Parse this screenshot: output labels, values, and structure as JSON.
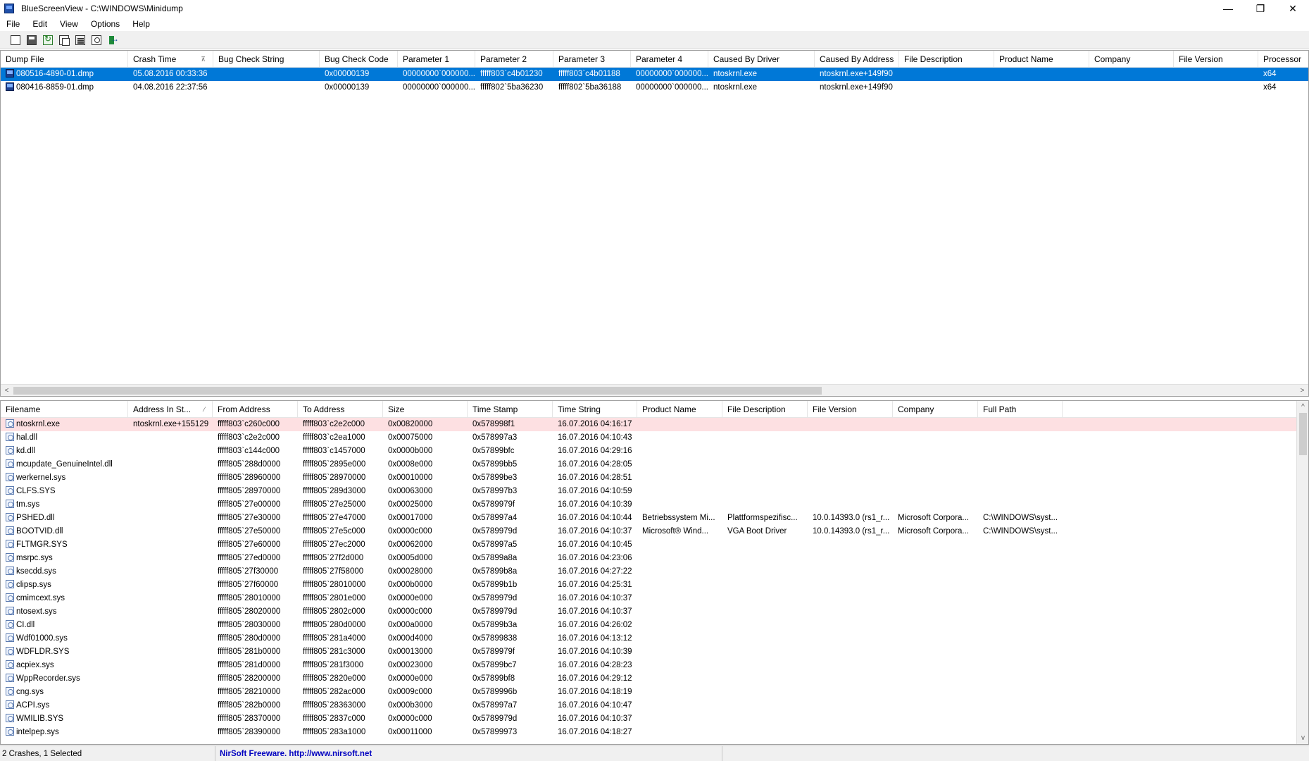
{
  "window": {
    "title": "BlueScreenView  -  C:\\WINDOWS\\Minidump",
    "controls": {
      "minimize": "—",
      "restore": "❐",
      "close": "✕"
    }
  },
  "menu": [
    "File",
    "Edit",
    "View",
    "Options",
    "Help"
  ],
  "toolbar": [
    "html-report-icon",
    "save-icon",
    "refresh-icon",
    "copy-icon",
    "properties-icon",
    "find-icon",
    "exit-icon"
  ],
  "colors": {
    "selection": "#0078d7",
    "highlight_row": "#fde0e2",
    "freeware_link": "#0000c0"
  },
  "crash_list": {
    "sort_indicator": "⊼",
    "columns": [
      "Dump File",
      "Crash Time",
      "Bug Check String",
      "Bug Check Code",
      "Parameter 1",
      "Parameter 2",
      "Parameter 3",
      "Parameter 4",
      "Caused By Driver",
      "Caused By Address",
      "File Description",
      "Product Name",
      "Company",
      "File Version",
      "Processor"
    ],
    "rows": [
      {
        "selected": true,
        "cells": [
          "080516-4890-01.dmp",
          "05.08.2016 00:33:36",
          "",
          "0x00000139",
          "00000000`000000...",
          "fffff803`c4b01230",
          "fffff803`c4b01188",
          "00000000`000000...",
          "ntoskrnl.exe",
          "ntoskrnl.exe+149f90",
          "",
          "",
          "",
          "",
          "x64"
        ]
      },
      {
        "selected": false,
        "cells": [
          "080416-8859-01.dmp",
          "04.08.2016 22:37:56",
          "",
          "0x00000139",
          "00000000`000000...",
          "fffff802`5ba36230",
          "fffff802`5ba36188",
          "00000000`000000...",
          "ntoskrnl.exe",
          "ntoskrnl.exe+149f90",
          "",
          "",
          "",
          "",
          "x64"
        ]
      }
    ]
  },
  "module_list": {
    "sort_indicator": "⁄",
    "columns": [
      "Filename",
      "Address In St...",
      "From Address",
      "To Address",
      "Size",
      "Time Stamp",
      "Time String",
      "Product Name",
      "File Description",
      "File Version",
      "Company",
      "Full Path"
    ],
    "rows": [
      {
        "highlight": true,
        "cells": [
          "ntoskrnl.exe",
          "ntoskrnl.exe+155129",
          "fffff803`c260c000",
          "fffff803`c2e2c000",
          "0x00820000",
          "0x578998f1",
          "16.07.2016 04:16:17",
          "",
          "",
          "",
          "",
          ""
        ]
      },
      {
        "highlight": false,
        "cells": [
          "hal.dll",
          "",
          "fffff803`c2e2c000",
          "fffff803`c2ea1000",
          "0x00075000",
          "0x578997a3",
          "16.07.2016 04:10:43",
          "",
          "",
          "",
          "",
          ""
        ]
      },
      {
        "highlight": false,
        "cells": [
          "kd.dll",
          "",
          "fffff803`c144c000",
          "fffff803`c1457000",
          "0x0000b000",
          "0x57899bfc",
          "16.07.2016 04:29:16",
          "",
          "",
          "",
          "",
          ""
        ]
      },
      {
        "highlight": false,
        "cells": [
          "mcupdate_GenuineIntel.dll",
          "",
          "fffff805`288d0000",
          "fffff805`2895e000",
          "0x0008e000",
          "0x57899bb5",
          "16.07.2016 04:28:05",
          "",
          "",
          "",
          "",
          ""
        ]
      },
      {
        "highlight": false,
        "cells": [
          "werkernel.sys",
          "",
          "fffff805`28960000",
          "fffff805`28970000",
          "0x00010000",
          "0x57899be3",
          "16.07.2016 04:28:51",
          "",
          "",
          "",
          "",
          ""
        ]
      },
      {
        "highlight": false,
        "cells": [
          "CLFS.SYS",
          "",
          "fffff805`28970000",
          "fffff805`289d3000",
          "0x00063000",
          "0x578997b3",
          "16.07.2016 04:10:59",
          "",
          "",
          "",
          "",
          ""
        ]
      },
      {
        "highlight": false,
        "cells": [
          "tm.sys",
          "",
          "fffff805`27e00000",
          "fffff805`27e25000",
          "0x00025000",
          "0x5789979f",
          "16.07.2016 04:10:39",
          "",
          "",
          "",
          "",
          ""
        ]
      },
      {
        "highlight": false,
        "cells": [
          "PSHED.dll",
          "",
          "fffff805`27e30000",
          "fffff805`27e47000",
          "0x00017000",
          "0x578997a4",
          "16.07.2016 04:10:44",
          "Betriebssystem Mi...",
          "Plattformspezifisc...",
          "10.0.14393.0 (rs1_r...",
          "Microsoft Corpora...",
          "C:\\WINDOWS\\syst..."
        ]
      },
      {
        "highlight": false,
        "cells": [
          "BOOTVID.dll",
          "",
          "fffff805`27e50000",
          "fffff805`27e5c000",
          "0x0000c000",
          "0x5789979d",
          "16.07.2016 04:10:37",
          "Microsoft® Wind...",
          "VGA Boot Driver",
          "10.0.14393.0 (rs1_r...",
          "Microsoft Corpora...",
          "C:\\WINDOWS\\syst..."
        ]
      },
      {
        "highlight": false,
        "cells": [
          "FLTMGR.SYS",
          "",
          "fffff805`27e60000",
          "fffff805`27ec2000",
          "0x00062000",
          "0x578997a5",
          "16.07.2016 04:10:45",
          "",
          "",
          "",
          "",
          ""
        ]
      },
      {
        "highlight": false,
        "cells": [
          "msrpc.sys",
          "",
          "fffff805`27ed0000",
          "fffff805`27f2d000",
          "0x0005d000",
          "0x57899a8a",
          "16.07.2016 04:23:06",
          "",
          "",
          "",
          "",
          ""
        ]
      },
      {
        "highlight": false,
        "cells": [
          "ksecdd.sys",
          "",
          "fffff805`27f30000",
          "fffff805`27f58000",
          "0x00028000",
          "0x57899b8a",
          "16.07.2016 04:27:22",
          "",
          "",
          "",
          "",
          ""
        ]
      },
      {
        "highlight": false,
        "cells": [
          "clipsp.sys",
          "",
          "fffff805`27f60000",
          "fffff805`28010000",
          "0x000b0000",
          "0x57899b1b",
          "16.07.2016 04:25:31",
          "",
          "",
          "",
          "",
          ""
        ]
      },
      {
        "highlight": false,
        "cells": [
          "cmimcext.sys",
          "",
          "fffff805`28010000",
          "fffff805`2801e000",
          "0x0000e000",
          "0x5789979d",
          "16.07.2016 04:10:37",
          "",
          "",
          "",
          "",
          ""
        ]
      },
      {
        "highlight": false,
        "cells": [
          "ntosext.sys",
          "",
          "fffff805`28020000",
          "fffff805`2802c000",
          "0x0000c000",
          "0x5789979d",
          "16.07.2016 04:10:37",
          "",
          "",
          "",
          "",
          ""
        ]
      },
      {
        "highlight": false,
        "cells": [
          "CI.dll",
          "",
          "fffff805`28030000",
          "fffff805`280d0000",
          "0x000a0000",
          "0x57899b3a",
          "16.07.2016 04:26:02",
          "",
          "",
          "",
          "",
          ""
        ]
      },
      {
        "highlight": false,
        "cells": [
          "Wdf01000.sys",
          "",
          "fffff805`280d0000",
          "fffff805`281a4000",
          "0x000d4000",
          "0x57899838",
          "16.07.2016 04:13:12",
          "",
          "",
          "",
          "",
          ""
        ]
      },
      {
        "highlight": false,
        "cells": [
          "WDFLDR.SYS",
          "",
          "fffff805`281b0000",
          "fffff805`281c3000",
          "0x00013000",
          "0x5789979f",
          "16.07.2016 04:10:39",
          "",
          "",
          "",
          "",
          ""
        ]
      },
      {
        "highlight": false,
        "cells": [
          "acpiex.sys",
          "",
          "fffff805`281d0000",
          "fffff805`281f3000",
          "0x00023000",
          "0x57899bc7",
          "16.07.2016 04:28:23",
          "",
          "",
          "",
          "",
          ""
        ]
      },
      {
        "highlight": false,
        "cells": [
          "WppRecorder.sys",
          "",
          "fffff805`28200000",
          "fffff805`2820e000",
          "0x0000e000",
          "0x57899bf8",
          "16.07.2016 04:29:12",
          "",
          "",
          "",
          "",
          ""
        ]
      },
      {
        "highlight": false,
        "cells": [
          "cng.sys",
          "",
          "fffff805`28210000",
          "fffff805`282ac000",
          "0x0009c000",
          "0x5789996b",
          "16.07.2016 04:18:19",
          "",
          "",
          "",
          "",
          ""
        ]
      },
      {
        "highlight": false,
        "cells": [
          "ACPI.sys",
          "",
          "fffff805`282b0000",
          "fffff805`28363000",
          "0x000b3000",
          "0x578997a7",
          "16.07.2016 04:10:47",
          "",
          "",
          "",
          "",
          ""
        ]
      },
      {
        "highlight": false,
        "cells": [
          "WMILIB.SYS",
          "",
          "fffff805`28370000",
          "fffff805`2837c000",
          "0x0000c000",
          "0x5789979d",
          "16.07.2016 04:10:37",
          "",
          "",
          "",
          "",
          ""
        ]
      },
      {
        "highlight": false,
        "cells": [
          "intelpep.sys",
          "",
          "fffff805`28390000",
          "fffff805`283a1000",
          "0x00011000",
          "0x57899973",
          "16.07.2016 04:18:27",
          "",
          "",
          "",
          "",
          ""
        ]
      }
    ]
  },
  "status": {
    "summary": "2 Crashes, 1 Selected",
    "freeware": "NirSoft Freeware.  http://www.nirsoft.net"
  }
}
